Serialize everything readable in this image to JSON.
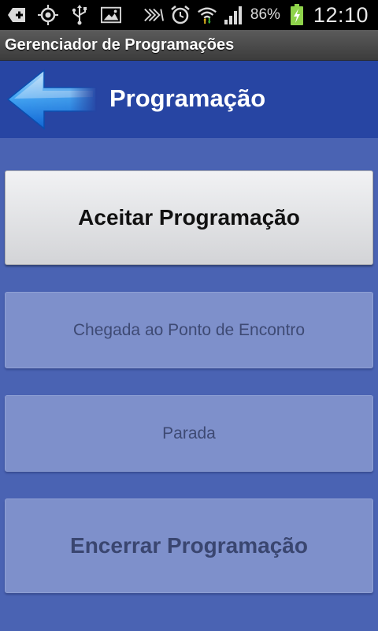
{
  "status_bar": {
    "battery_percent": "86%",
    "time": "12:10",
    "left_icons": [
      "add-icon",
      "gps-icon",
      "usb-icon",
      "image-icon"
    ],
    "right_icons": [
      "vibrate-icon",
      "alarm-icon",
      "wifi-icon",
      "signal-icon",
      "battery-charging-icon"
    ]
  },
  "app": {
    "title": "Gerenciador de Programações"
  },
  "header": {
    "title": "Programação",
    "back_icon": "back-arrow-icon"
  },
  "actions": {
    "aceitar": "Aceitar Programação",
    "chegada": "Chegada ao Ponto de Encontro",
    "parada": "Parada",
    "encerrar": "Encerrar Programação"
  },
  "colors": {
    "background": "#4a63b3",
    "header": "#2745a3",
    "button_active": "#e3e4e6",
    "button_disabled": "#7e90cb"
  }
}
